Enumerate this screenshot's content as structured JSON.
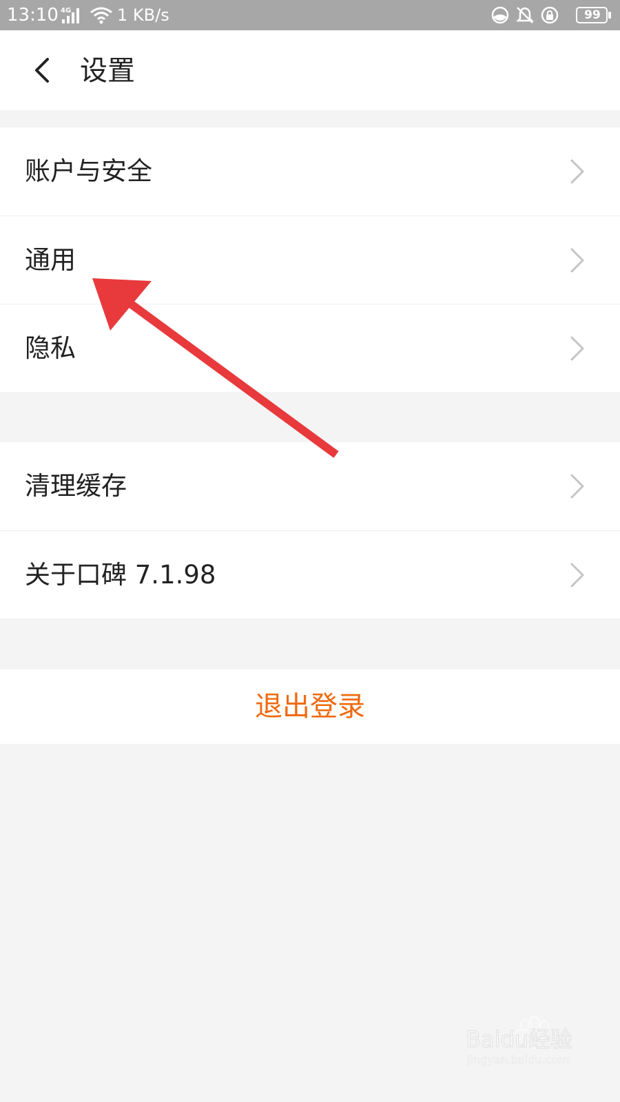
{
  "status_bar": {
    "time": "13:10",
    "network_type": "4G",
    "speed": "1 KB/s",
    "battery": "99"
  },
  "header": {
    "title": "设置"
  },
  "groups": [
    {
      "items": [
        {
          "label": "账户与安全"
        },
        {
          "label": "通用"
        },
        {
          "label": "隐私"
        }
      ]
    },
    {
      "items": [
        {
          "label": "清理缓存"
        },
        {
          "label": "关于口碑 7.1.98"
        }
      ]
    }
  ],
  "logout": {
    "label": "退出登录"
  },
  "watermark": {
    "brand": "Baidu经验",
    "url": "jingyan.baidu.com"
  },
  "colors": {
    "status_bar": "#a7a7a7",
    "background": "#f4f4f4",
    "logout_text": "#ef6a0f",
    "annotation_arrow": "#e8393c"
  }
}
